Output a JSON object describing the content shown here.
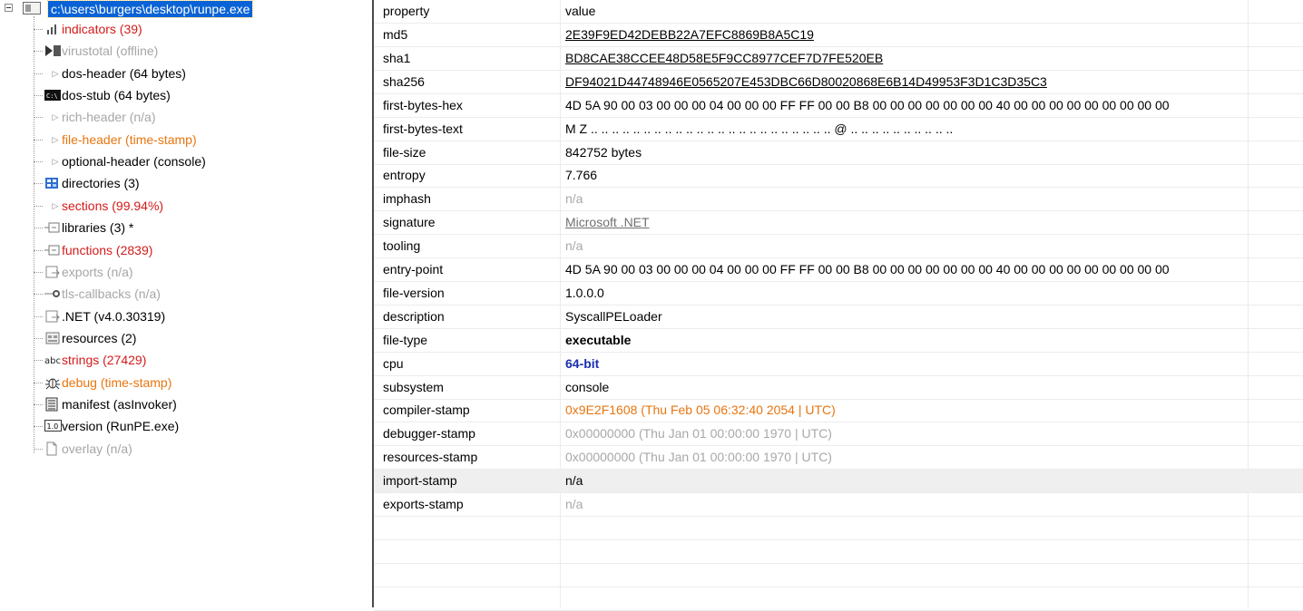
{
  "tree": {
    "root_label": "c:\\users\\burgers\\desktop\\runpe.exe",
    "items": [
      {
        "label": "indicators (39)",
        "color": "red",
        "icon": "bar-chart-icon"
      },
      {
        "label": "virustotal (offline)",
        "color": "gray",
        "icon": "virustotal-icon"
      },
      {
        "label": "dos-header (64 bytes)",
        "color": "black",
        "icon": "expand-triangle-icon"
      },
      {
        "label": "dos-stub (64 bytes)",
        "color": "black",
        "icon": "console-icon"
      },
      {
        "label": "rich-header (n/a)",
        "color": "gray",
        "icon": "expand-triangle-icon"
      },
      {
        "label": "file-header (time-stamp)",
        "color": "orange",
        "icon": "expand-triangle-icon"
      },
      {
        "label": "optional-header (console)",
        "color": "black",
        "icon": "expand-triangle-icon"
      },
      {
        "label": "directories (3)",
        "color": "black",
        "icon": "directories-icon"
      },
      {
        "label": "sections (99.94%)",
        "color": "red",
        "icon": "expand-triangle-icon"
      },
      {
        "label": "libraries (3) *",
        "color": "black",
        "icon": "library-icon"
      },
      {
        "label": "functions (2839)",
        "color": "red",
        "icon": "function-icon"
      },
      {
        "label": "exports (n/a)",
        "color": "gray",
        "icon": "export-icon"
      },
      {
        "label": "tls-callbacks (n/a)",
        "color": "gray",
        "icon": "callback-icon"
      },
      {
        "label": ".NET (v4.0.30319)",
        "color": "black",
        "icon": "dotnet-icon"
      },
      {
        "label": "resources (2)",
        "color": "black",
        "icon": "resources-icon"
      },
      {
        "label": "strings (27429)",
        "color": "red",
        "icon": "abc-icon"
      },
      {
        "label": "debug (time-stamp)",
        "color": "orange",
        "icon": "bug-icon"
      },
      {
        "label": "manifest (asInvoker)",
        "color": "black",
        "icon": "manifest-icon"
      },
      {
        "label": "version (RunPE.exe)",
        "color": "black",
        "icon": "version-icon"
      },
      {
        "label": "overlay (n/a)",
        "color": "gray",
        "icon": "page-icon"
      }
    ]
  },
  "grid": {
    "header": {
      "property": "property",
      "value": "value"
    },
    "rows": [
      {
        "property": "md5",
        "value": "2E39F9ED42DEBB22A7EFC8869B8A5C19",
        "style": "u"
      },
      {
        "property": "sha1",
        "value": "BD8CAE38CCEE48D58E5F9CC8977CEF7D7FE520EB",
        "style": "u"
      },
      {
        "property": "sha256",
        "value": "DF94021D44748946E0565207E453DBC66D80020868E6B14D49953F3D1C3D35C3",
        "style": "u"
      },
      {
        "property": "first-bytes-hex",
        "value": "4D 5A 90 00 03 00 00 00 04 00 00 00 FF FF 00 00 B8 00 00 00 00 00 00 00 40 00 00 00 00 00 00 00 00 00",
        "style": ""
      },
      {
        "property": "first-bytes-text",
        "value": "M Z .. .. .. .. .. .. .. .. .. .. .. .. .. .. .. .. .. .. .. .. .. .. .. @ .. .. .. .. .. .. .. .. .. ..",
        "style": ""
      },
      {
        "property": "file-size",
        "value": "842752 bytes",
        "style": ""
      },
      {
        "property": "entropy",
        "value": "7.766",
        "style": ""
      },
      {
        "property": "imphash",
        "value": "n/a",
        "style": "vgray"
      },
      {
        "property": "signature",
        "value": "Microsoft .NET",
        "style": "ugray"
      },
      {
        "property": "tooling",
        "value": "n/a",
        "style": "vgray"
      },
      {
        "property": "entry-point",
        "value": "4D 5A 90 00 03 00 00 00 04 00 00 00 FF FF 00 00 B8 00 00 00 00 00 00 00 40 00 00 00 00 00 00 00 00 00",
        "style": ""
      },
      {
        "property": "file-version",
        "value": "1.0.0.0",
        "style": ""
      },
      {
        "property": "description",
        "value": "SyscallPELoader",
        "style": ""
      },
      {
        "property": "file-type",
        "value": "executable",
        "style": "bold"
      },
      {
        "property": "cpu",
        "value": "64-bit",
        "style": "blue"
      },
      {
        "property": "subsystem",
        "value": "console",
        "style": ""
      },
      {
        "property": "compiler-stamp",
        "value": "0x9E2F1608 (Thu Feb 05 06:32:40 2054 | UTC)",
        "style": "vorange"
      },
      {
        "property": "debugger-stamp",
        "value": "0x00000000 (Thu Jan 01 00:00:00 1970 | UTC)",
        "style": "vgray"
      },
      {
        "property": "resources-stamp",
        "value": "0x00000000 (Thu Jan 01 00:00:00 1970 | UTC)",
        "style": "vgray"
      },
      {
        "property": "import-stamp",
        "value": "n/a",
        "style": "",
        "selected": true
      },
      {
        "property": "exports-stamp",
        "value": "n/a",
        "style": "vgray"
      }
    ]
  },
  "colors": {
    "selection": "#0a63d6",
    "red": "#d41a1a",
    "orange": "#e87510",
    "blue": "#1a2fb0",
    "gray": "#a6a6a6"
  }
}
